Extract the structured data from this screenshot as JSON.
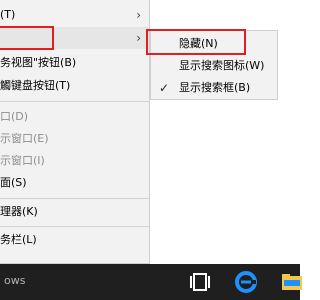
{
  "context_menu": {
    "items": [
      {
        "label": "(T)",
        "state": "normal",
        "has_submenu": true
      },
      {
        "label": "",
        "state": "highlighted",
        "has_submenu": true
      },
      {
        "label": "务视图\"按钮(B)",
        "state": "normal",
        "has_submenu": false
      },
      {
        "label": "觸键盘按钮(T)",
        "state": "normal",
        "has_submenu": false
      },
      {
        "label": "口(D)",
        "state": "disabled",
        "has_submenu": false
      },
      {
        "label": "示窗口(E)",
        "state": "disabled",
        "has_submenu": false
      },
      {
        "label": "示窗口(I)",
        "state": "disabled",
        "has_submenu": false
      },
      {
        "label": "面(S)",
        "state": "normal",
        "has_submenu": false
      },
      {
        "label": "理器(K)",
        "state": "normal",
        "has_submenu": false
      },
      {
        "label": "务栏(L)",
        "state": "normal",
        "has_submenu": false
      }
    ]
  },
  "submenu": {
    "items": [
      {
        "label": "隐藏(N)",
        "checked": false
      },
      {
        "label": "显示搜索图标(W)",
        "checked": false
      },
      {
        "label": "显示搜索框(B)",
        "checked": true
      }
    ],
    "check_glyph": "✓"
  },
  "taskbar": {
    "search_text": "ows",
    "icons": [
      "task-view-icon",
      "edge-icon",
      "file-explorer-icon"
    ]
  },
  "colors": {
    "highlight_border": "#e02020",
    "menu_background": "#f2f2f2",
    "taskbar_background": "#1f1f1f",
    "edge_blue": "#1e90ff",
    "explorer_yellow": "#f2c94c"
  }
}
